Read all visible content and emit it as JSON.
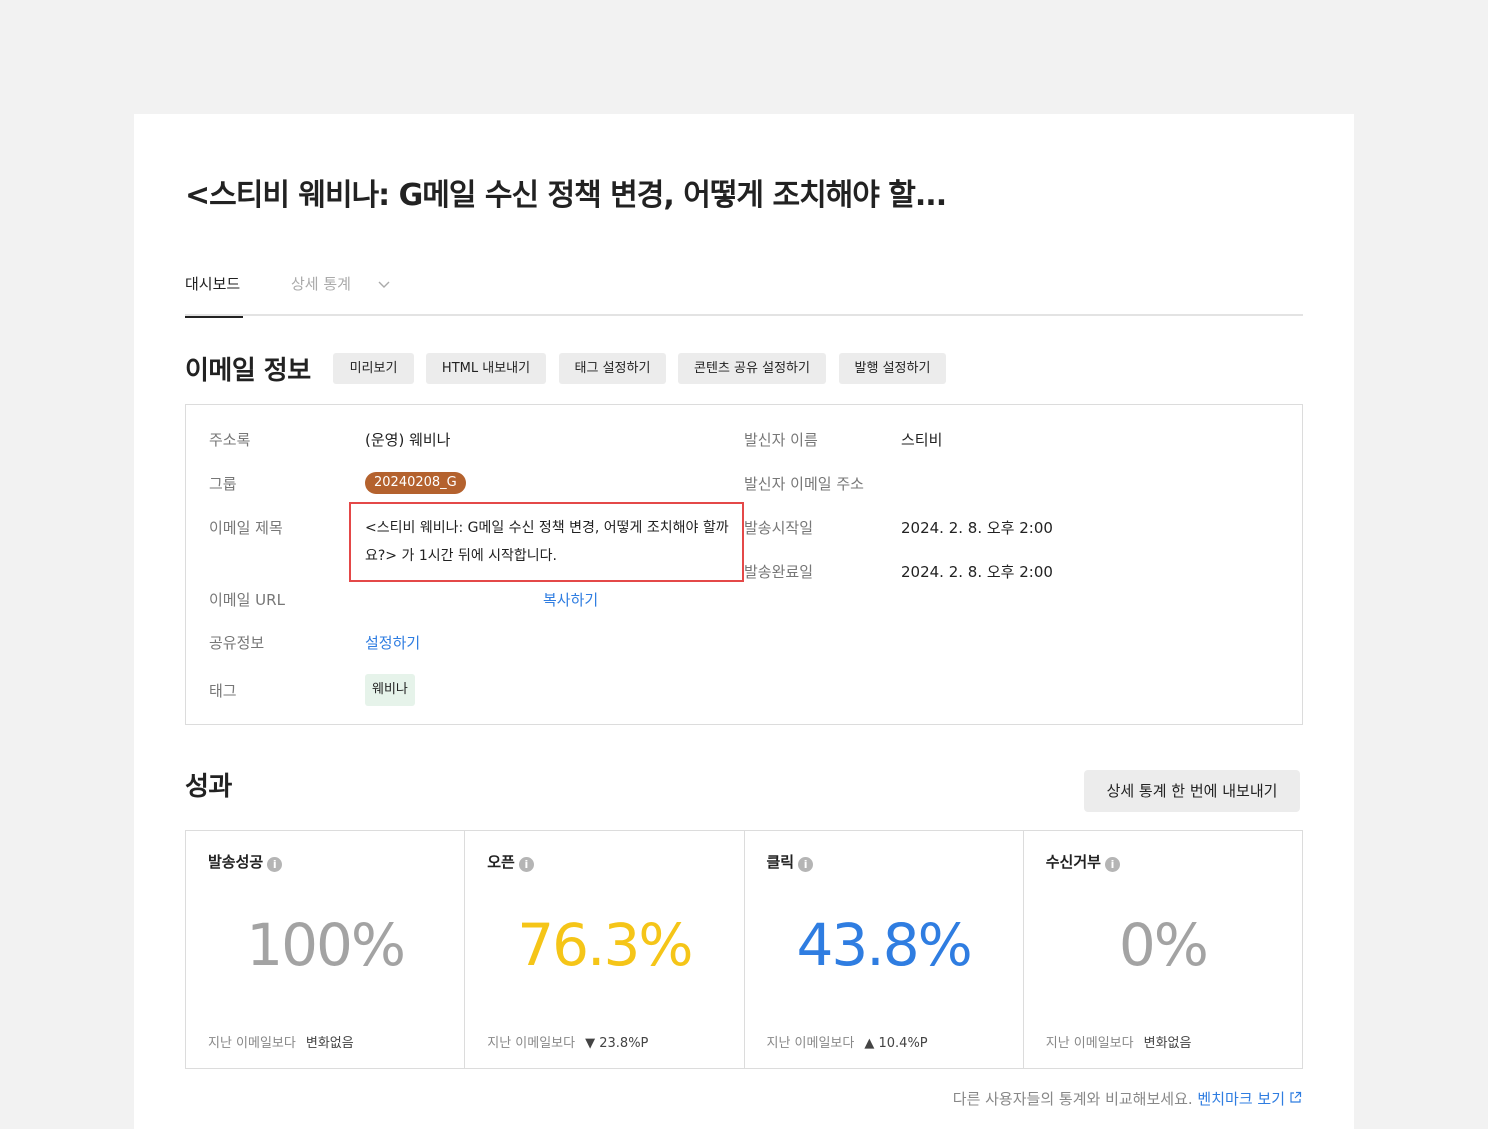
{
  "page": {
    "title": "<스티비 웨비나: G메일 수신 정책 변경, 어떻게 조치해야 할..."
  },
  "tabs": [
    {
      "label": "대시보드",
      "active": true
    },
    {
      "label": "상세 통계",
      "active": false
    }
  ],
  "email_info": {
    "title": "이메일 정보",
    "buttons": [
      "미리보기",
      "HTML 내보내기",
      "태그 설정하기",
      "콘텐츠 공유 설정하기",
      "발행 설정하기"
    ],
    "fields": {
      "address_book": {
        "label": "주소록",
        "value": "(운영) 웨비나"
      },
      "group": {
        "label": "그룹",
        "value": "20240208_G"
      },
      "subject": {
        "label": "이메일 제목",
        "value": "<스티비 웨비나: G메일 수신 정책 변경, 어떻게 조치해야 할까요?> 가 1시간 뒤에 시작합니다."
      },
      "url": {
        "label": "이메일 URL",
        "action": "복사하기"
      },
      "share": {
        "label": "공유정보",
        "action": "설정하기"
      },
      "tag": {
        "label": "태그",
        "value": "웨비나"
      },
      "sender_name": {
        "label": "발신자 이름",
        "value": "스티비"
      },
      "sender_email": {
        "label": "발신자 이메일 주소",
        "value": ""
      },
      "send_start": {
        "label": "발송시작일",
        "value": "2024. 2. 8. 오후 2:00"
      },
      "send_end": {
        "label": "발송완료일",
        "value": "2024. 2. 8. 오후 2:00"
      }
    }
  },
  "performance": {
    "title": "성과",
    "export_label": "상세 통계 한 번에 내보내기",
    "compare_label": "지난 이메일보다",
    "metrics": [
      {
        "title": "발송성공",
        "value": "100%",
        "color": "#a3a3a3",
        "change": "변화없음",
        "trend": "none"
      },
      {
        "title": "오픈",
        "value": "76.3%",
        "color": "#f5c518",
        "change": "23.8%P",
        "trend": "down"
      },
      {
        "title": "클릭",
        "value": "43.8%",
        "color": "#2f7de1",
        "change": "10.4%P",
        "trend": "up"
      },
      {
        "title": "수신거부",
        "value": "0%",
        "color": "#a3a3a3",
        "change": "변화없음",
        "trend": "none"
      }
    ],
    "benchmark_text": "다른 사용자들의 통계와 비교해보세요.",
    "benchmark_link": "벤치마크 보기"
  }
}
